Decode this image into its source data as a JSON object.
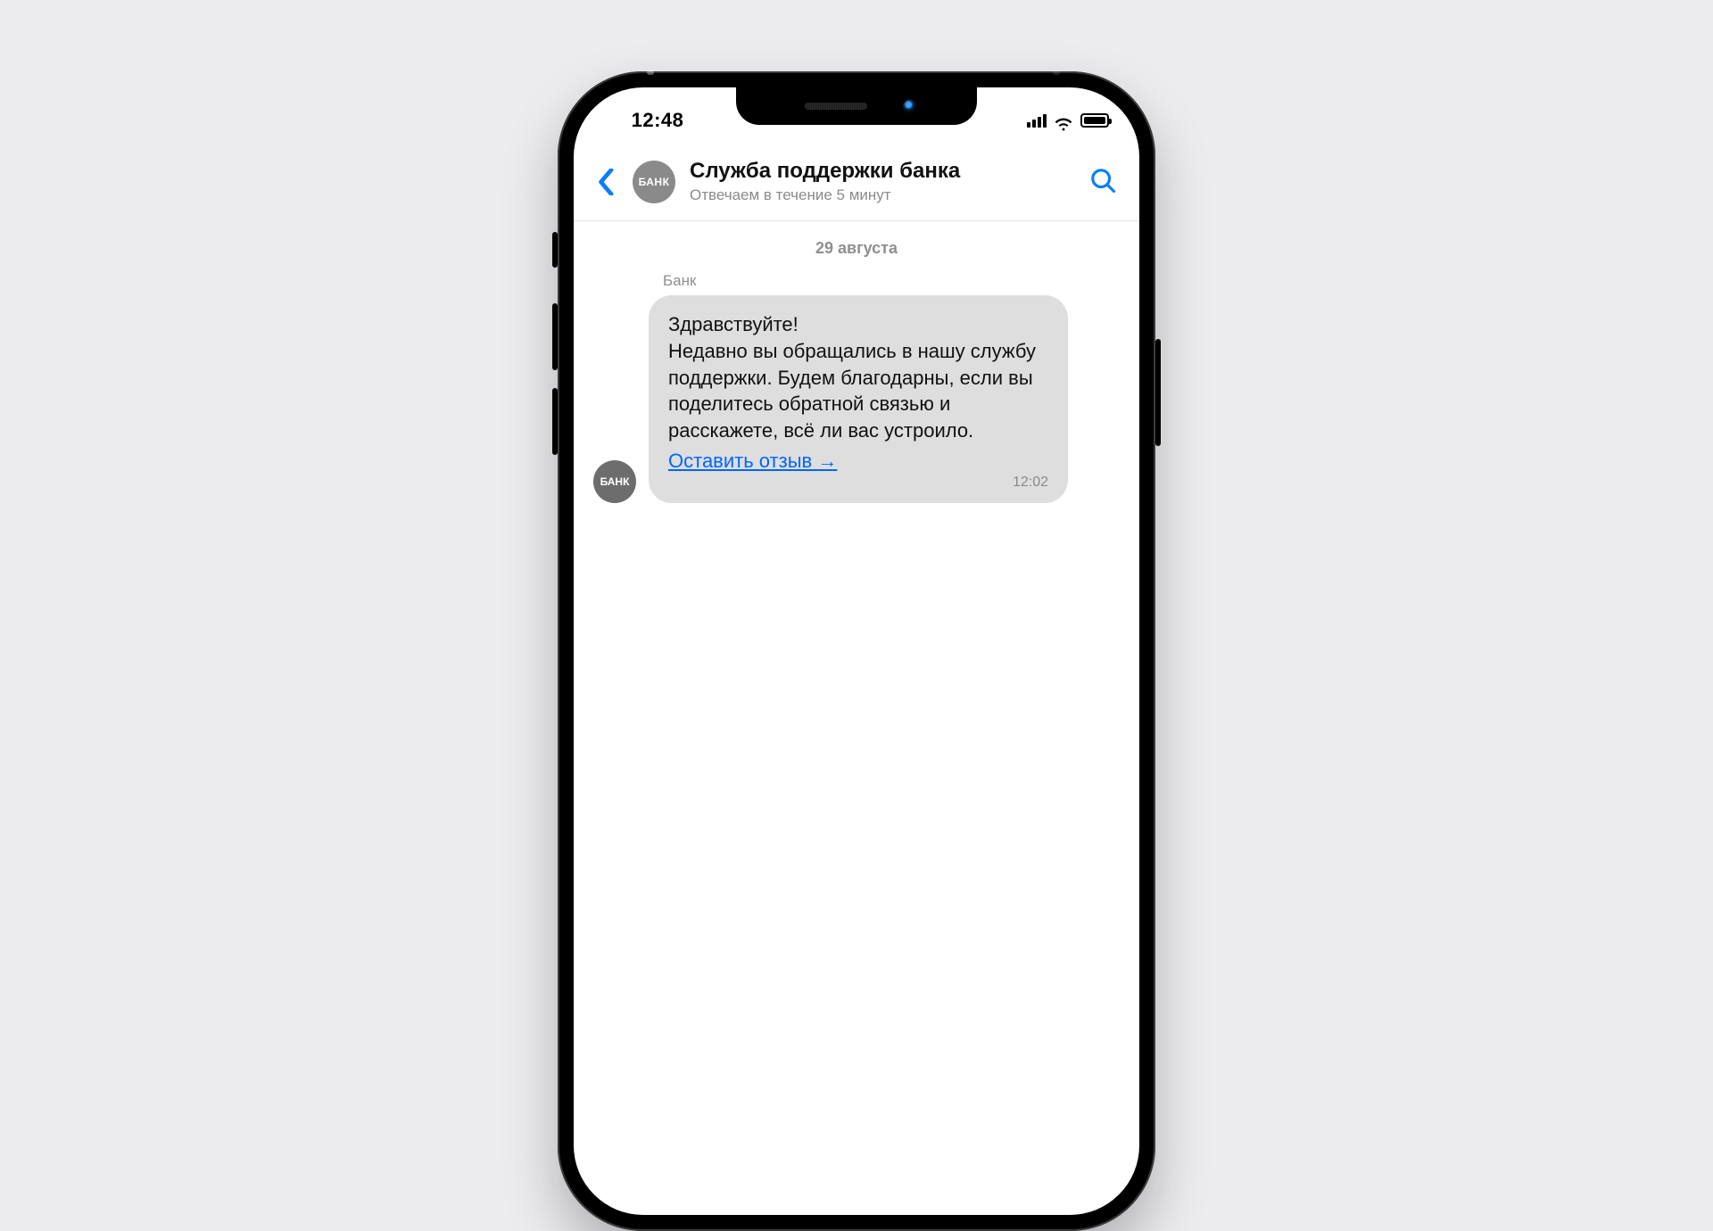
{
  "status": {
    "time": "12:48"
  },
  "avatar_label": "БАНК",
  "header": {
    "title": "Служба поддержки банка",
    "subtitle": "Отвечаем в течение 5 минут"
  },
  "chat": {
    "date_separator": "29 августа",
    "message": {
      "sender": "Банк",
      "avatar_label": "БАНК",
      "body": "Здравствуйте!\nНедавно вы обращались в нашу службу поддержки. Будем благодарны, если вы поделитесь обратной связью и расскажете, всё ли вас устроило.",
      "link_text": "Оставить отзыв →",
      "time": "12:02"
    }
  },
  "colors": {
    "accent": "#0a7dff",
    "bubble_bg": "#dedede",
    "page_bg": "#ececef"
  }
}
